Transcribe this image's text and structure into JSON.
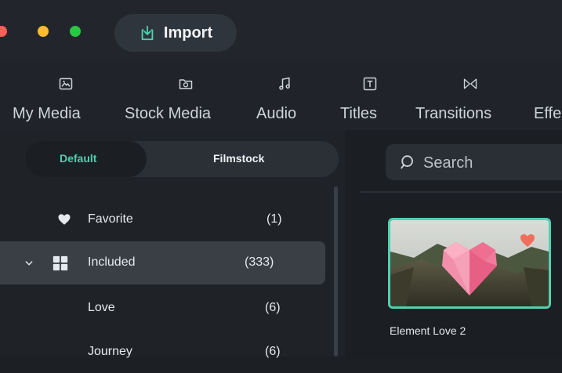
{
  "window": {
    "traffic_lights": [
      {
        "name": "close",
        "color": "#ff5f57"
      },
      {
        "name": "minimize",
        "color": "#febc2e"
      },
      {
        "name": "zoom",
        "color": "#28c840"
      }
    ]
  },
  "header": {
    "import_label": "Import",
    "import_icon": "import-icon"
  },
  "toolbar": {
    "tabs": [
      {
        "label": "My Media",
        "icon": "image-icon"
      },
      {
        "label": "Stock Media",
        "icon": "folder-icon"
      },
      {
        "label": "Audio",
        "icon": "music-note-icon"
      },
      {
        "label": "Titles",
        "icon": "text-icon"
      },
      {
        "label": "Transitions",
        "icon": "transitions-icon"
      },
      {
        "label": "Effe",
        "icon": "effects-icon"
      }
    ]
  },
  "sidebar": {
    "segments": [
      {
        "label": "Default",
        "active": true,
        "color": "#4fd1b1"
      },
      {
        "label": "Filmstock",
        "active": false,
        "color": "#f1f3f6"
      }
    ],
    "items": [
      {
        "label": "Favorite",
        "count": "(1)",
        "icon": "heart-icon"
      },
      {
        "label": "Included",
        "count": "(333)",
        "icon": "grid-icon",
        "selected": true,
        "expanded": true
      },
      {
        "label": "Love",
        "count": "(6)"
      },
      {
        "label": "Journey",
        "count": "(6)"
      }
    ]
  },
  "main": {
    "search_placeholder": "Search",
    "items": [
      {
        "title": "Element Love 2",
        "selected": true,
        "favorite": true
      }
    ]
  },
  "colors": {
    "accent": "#4fd1b1",
    "heart": "#f26d5b"
  }
}
